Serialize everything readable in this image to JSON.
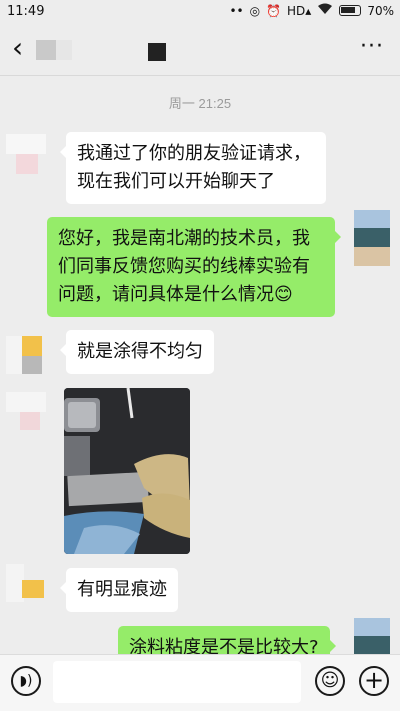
{
  "status_bar": {
    "time": "11:49",
    "battery": "70%"
  },
  "header": {
    "back_icon": "chevron-left-icon",
    "more_label": "···"
  },
  "chat": {
    "timestamp": "周一 21:25",
    "messages": [
      {
        "side": "in",
        "text": "我通过了你的朋友验证请求，现在我们可以开始聊天了"
      },
      {
        "side": "out",
        "text": "您好，我是南北潮的技术员，我们同事反馈您购买的线棒实验有问题，请问具体是什么情况😊"
      },
      {
        "side": "in",
        "text": "就是涂得不均匀"
      },
      {
        "side": "in",
        "type": "image",
        "description": "photo"
      },
      {
        "side": "in",
        "text": "有明显痕迹"
      },
      {
        "side": "out",
        "text": "涂料粘度是不是比较大?"
      }
    ]
  },
  "input_bar": {
    "voice_icon": "voice-icon",
    "emoji_icon": "emoji-icon",
    "plus_icon": "plus-icon",
    "input_value": ""
  },
  "colors": {
    "background": "#ededed",
    "incoming_bubble": "#ffffff",
    "outgoing_bubble": "#95ec69",
    "timestamp": "#9b9b9b"
  }
}
